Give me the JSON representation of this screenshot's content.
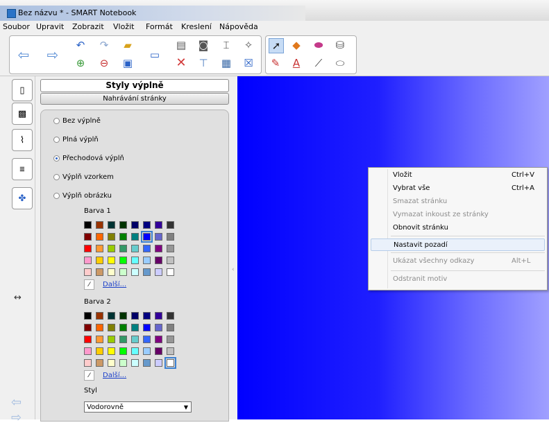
{
  "window": {
    "title": "Bez názvu * - SMART Notebook"
  },
  "menu": [
    "Soubor",
    "Upravit",
    "Zobrazit",
    "Vložit",
    "Formát",
    "Kreslení",
    "Nápověda"
  ],
  "panel": {
    "title": "Styly výplně",
    "subtitle": "Nahrávání stránky",
    "fill_options": [
      {
        "label": "Bez výplně",
        "selected": false
      },
      {
        "label": "Plná výplň",
        "selected": false
      },
      {
        "label": "Přechodová výplň",
        "selected": true
      },
      {
        "label": "Výplň vzorkem",
        "selected": false
      },
      {
        "label": "Výplň obrázku",
        "selected": false
      }
    ],
    "color1_label": "Barva 1",
    "color2_label": "Barva 2",
    "more_label": "Další...",
    "style_label": "Styl",
    "style_value": "Vodorovně"
  },
  "palette": [
    "#000000",
    "#993300",
    "#003333",
    "#003300",
    "#000066",
    "#000080",
    "#330099",
    "#333333",
    "#800000",
    "#ff6600",
    "#808000",
    "#008000",
    "#008080",
    "#0000ff",
    "#6666cc",
    "#808080",
    "#ff0000",
    "#ff9933",
    "#99cc00",
    "#339966",
    "#66cccc",
    "#3366ff",
    "#800080",
    "#969696",
    "#ff99cc",
    "#ffcc00",
    "#ffff00",
    "#00ff00",
    "#66ffff",
    "#99ccff",
    "#660066",
    "#c0c0c0",
    "#ffcccc",
    "#cc9966",
    "#ffffcc",
    "#ccffcc",
    "#ccffff",
    "#6699cc",
    "#ccccff",
    "#ffffff"
  ],
  "palette1_selected": 13,
  "palette2_selected": 39,
  "context_menu": [
    {
      "label": "Vložit",
      "shortcut": "Ctrl+V",
      "disabled": false,
      "highlight": false
    },
    {
      "label": "Vybrat vše",
      "shortcut": "Ctrl+A",
      "disabled": false,
      "highlight": false
    },
    {
      "label": "Smazat stránku",
      "shortcut": "",
      "disabled": true,
      "highlight": false
    },
    {
      "label": "Vymazat inkoust ze stránky",
      "shortcut": "",
      "disabled": true,
      "highlight": false
    },
    {
      "label": "Obnovit stránku",
      "shortcut": "",
      "disabled": false,
      "highlight": false
    },
    {
      "label": "Nastavit pozadí",
      "shortcut": "",
      "disabled": false,
      "highlight": true
    },
    {
      "label": "Ukázat všechny odkazy",
      "shortcut": "Alt+L",
      "disabled": true,
      "highlight": false
    },
    {
      "label": "Odstranit motiv",
      "shortcut": "",
      "disabled": true,
      "highlight": false
    }
  ],
  "side_tabs": [
    "page-sorter-icon",
    "gallery-icon",
    "attachments-icon",
    "properties-icon",
    "addons-icon"
  ],
  "colors": {
    "canvas_start": "#0000ff",
    "canvas_end": "#a0a0ff",
    "link": "#1a3fc9"
  }
}
